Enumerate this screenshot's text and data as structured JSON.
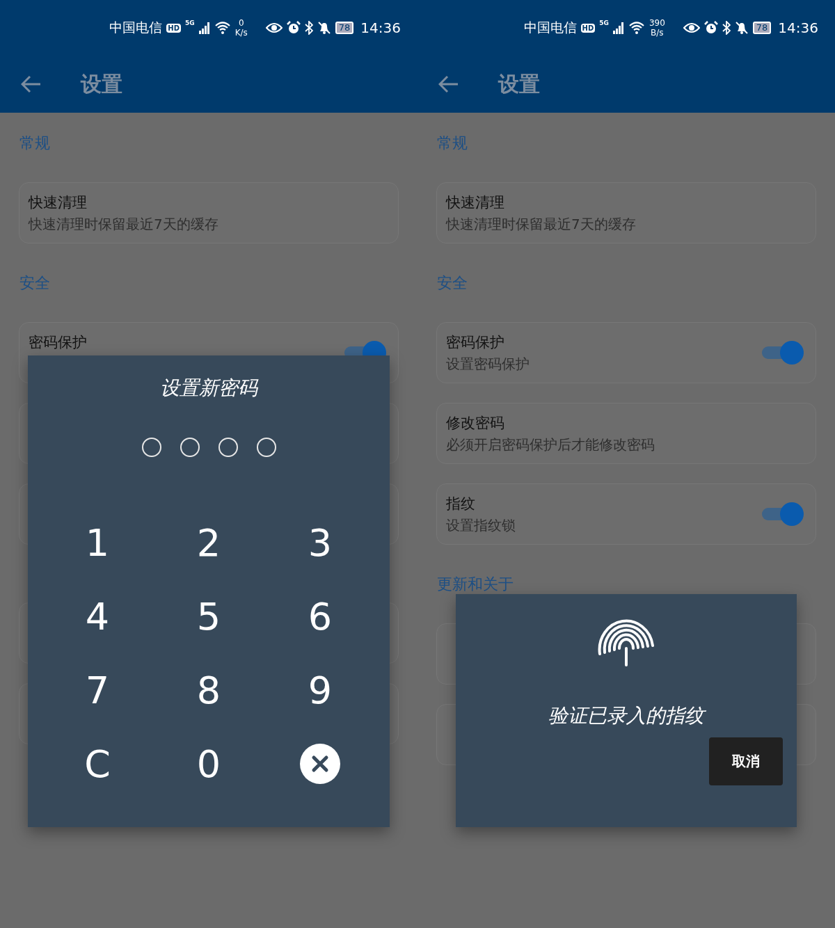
{
  "screens": [
    {
      "status_bar": {
        "carrier": "中国电信",
        "hd": "HD",
        "network": "5G",
        "speed_value": "0",
        "speed_unit": "K/s",
        "battery": "78",
        "time": "14:36"
      },
      "app_bar": {
        "title": "设置"
      },
      "sections": [
        {
          "header": "常规",
          "items": [
            {
              "kind": "setting",
              "title": "快速清理",
              "subtitle": "快速清理时保留最近7天的缓存"
            }
          ]
        },
        {
          "header": "安全",
          "items": [
            {
              "kind": "setting",
              "title": "密码保护",
              "toggle": true
            },
            {
              "kind": "setting"
            },
            {
              "kind": "setting"
            }
          ]
        },
        {
          "items": [
            {
              "kind": "setting"
            },
            {
              "kind": "setting"
            }
          ]
        }
      ],
      "dialog": {
        "kind": "pin",
        "title": "设置新密码",
        "pin_dots": [
          {
            "filled": false
          },
          {
            "filled": false
          },
          {
            "filled": false
          },
          {
            "filled": false
          }
        ],
        "keys": [
          {
            "kind": "digit",
            "label": "1"
          },
          {
            "kind": "digit",
            "label": "2"
          },
          {
            "kind": "digit",
            "label": "3"
          },
          {
            "kind": "digit",
            "label": "4"
          },
          {
            "kind": "digit",
            "label": "5"
          },
          {
            "kind": "digit",
            "label": "6"
          },
          {
            "kind": "digit",
            "label": "7"
          },
          {
            "kind": "digit",
            "label": "8"
          },
          {
            "kind": "digit",
            "label": "9"
          },
          {
            "kind": "digit",
            "label": "C"
          },
          {
            "kind": "digit",
            "label": "0"
          },
          {
            "kind": "delete"
          }
        ]
      }
    },
    {
      "status_bar": {
        "carrier": "中国电信",
        "hd": "HD",
        "network": "5G",
        "speed_value": "390",
        "speed_unit": "B/s",
        "battery": "78",
        "time": "14:36"
      },
      "app_bar": {
        "title": "设置"
      },
      "sections": [
        {
          "header": "常规",
          "items": [
            {
              "kind": "setting",
              "title": "快速清理",
              "subtitle": "快速清理时保留最近7天的缓存"
            }
          ]
        },
        {
          "header": "安全",
          "items": [
            {
              "kind": "setting",
              "title": "密码保护",
              "subtitle": "设置密码保护",
              "toggle": true
            },
            {
              "kind": "setting",
              "title": "修改密码",
              "subtitle": "必须开启密码保护后才能修改密码"
            },
            {
              "kind": "setting",
              "title": "指纹",
              "subtitle": "设置指纹锁",
              "toggle": true
            }
          ]
        },
        {
          "header": "更新和关于",
          "items": [
            {
              "kind": "setting"
            },
            {
              "kind": "setting"
            }
          ]
        }
      ],
      "dialog": {
        "kind": "fingerprint",
        "message": "验证已录入的指纹",
        "button": "取消"
      }
    }
  ]
}
